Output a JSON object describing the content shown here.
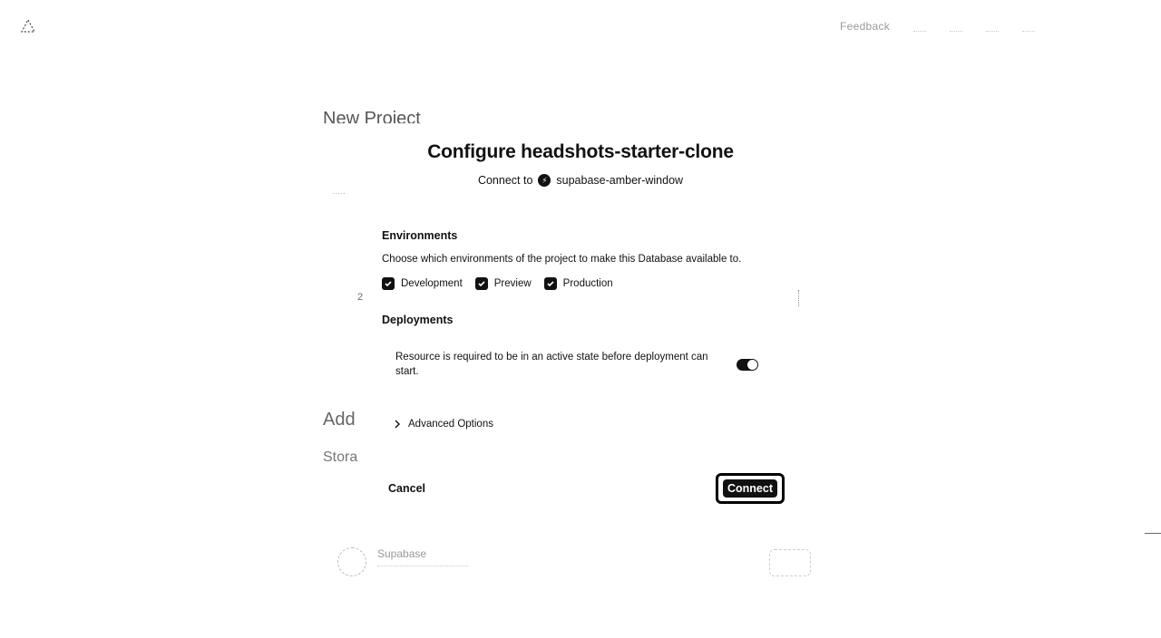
{
  "topbar": {
    "logo_icon": "vercel-triangle-icon",
    "feedback_label": "Feedback"
  },
  "background": {
    "page_title": "New Project",
    "add_heading": "Add",
    "storage_heading": "Stora",
    "number_label": "2",
    "card_title": "Supabase"
  },
  "modal": {
    "title": "Configure headshots-starter-clone",
    "connect_to_label": "Connect to",
    "database_name": "supabase-amber-window",
    "environments_title": "Environments",
    "environments_desc": "Choose which environments of the project to make this Database available to.",
    "environments": [
      {
        "label": "Development",
        "checked": true
      },
      {
        "label": "Preview",
        "checked": true
      },
      {
        "label": "Production",
        "checked": true
      }
    ],
    "deployments_title": "Deployments",
    "deployments_desc": "Resource is required to be in an active state before deployment can start.",
    "deployments_toggle_on": true,
    "advanced_options_label": "Advanced Options",
    "cancel_label": "Cancel",
    "connect_label": "Connect"
  }
}
